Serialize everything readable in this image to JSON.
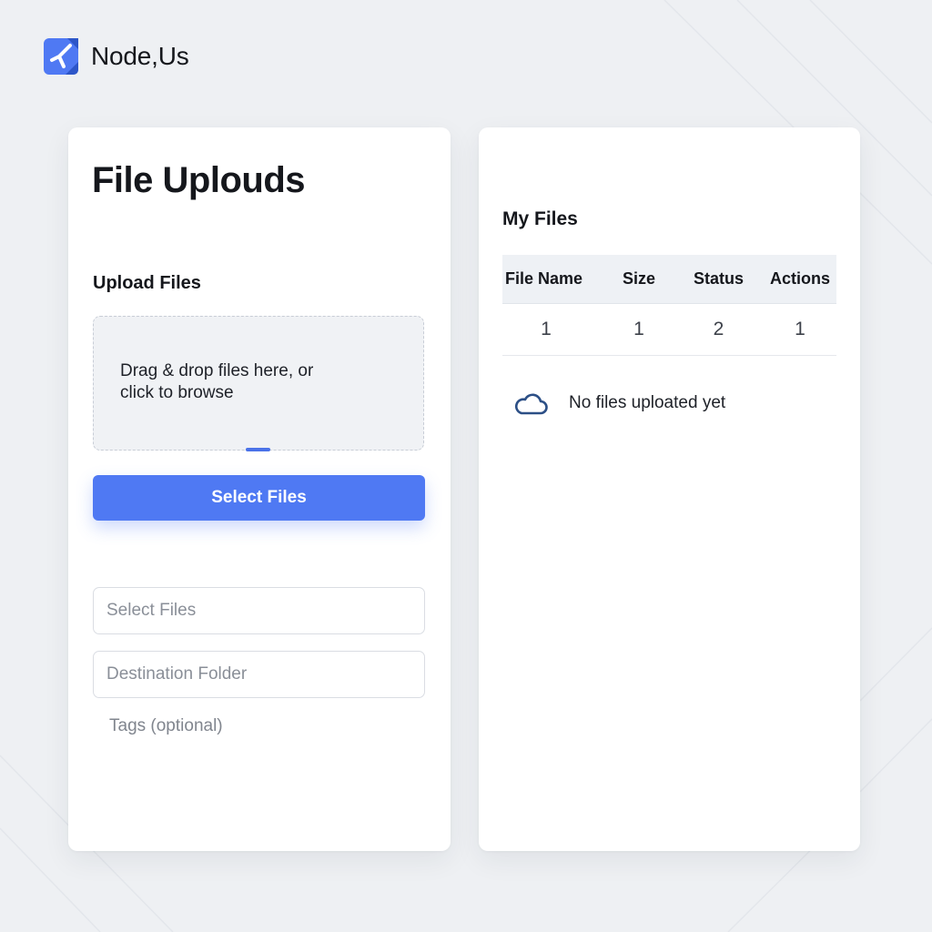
{
  "brand": {
    "name": "Node,Us",
    "logo_icon": "app-logo-icon",
    "logo_color": "#4f79f3"
  },
  "upload_panel": {
    "title": "File Uplouds",
    "section_label": "Upload Files",
    "dropzone_text": "Drag & drop files here, or click to browse",
    "select_button_label": "Select Files",
    "select_files_placeholder": "Select Files",
    "destination_placeholder": "Destination Folder",
    "tags_label": "Tags (optional)"
  },
  "files_panel": {
    "title": "My Files",
    "columns": [
      "File Name",
      "Size",
      "Status",
      "Actions"
    ],
    "rows": [
      [
        "1",
        "1",
        "2",
        "1"
      ]
    ],
    "empty_icon": "cloud-icon",
    "empty_text": "No files uploated yet"
  },
  "colors": {
    "accent": "#4f79f3",
    "background": "#eef0f3",
    "card": "#ffffff"
  }
}
